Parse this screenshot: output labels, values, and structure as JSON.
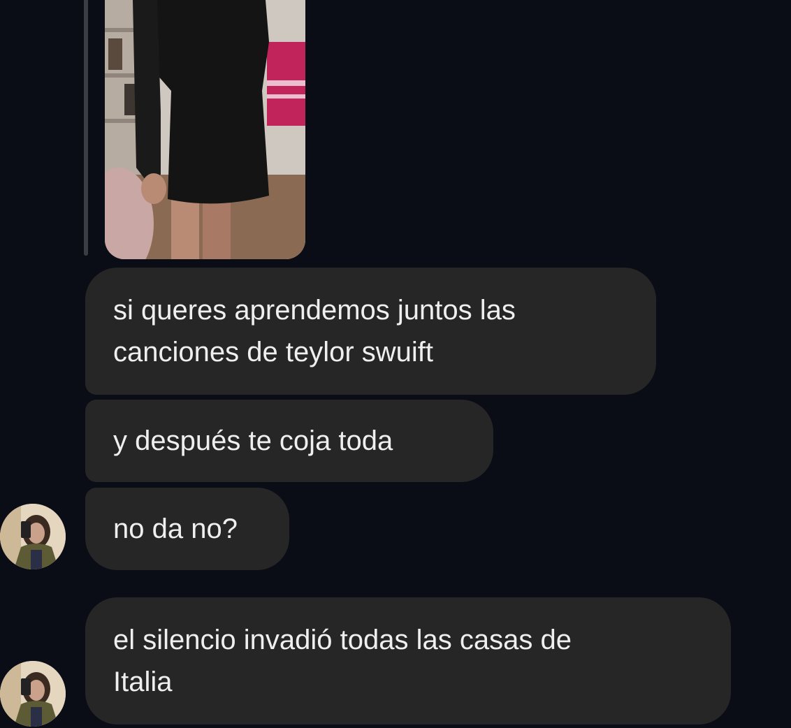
{
  "messages": [
    {
      "lines": [
        "si queres aprendemos juntos las",
        "canciones de teylor swuift"
      ]
    },
    {
      "lines": [
        "y después te coja toda"
      ]
    },
    {
      "lines": [
        "no da no?"
      ]
    },
    {
      "lines": [
        "el silencio invadió todas las casas de",
        "Italia"
      ]
    }
  ],
  "colors": {
    "background": "#0b0d16",
    "bubble": "#262626",
    "text": "#efefef"
  }
}
